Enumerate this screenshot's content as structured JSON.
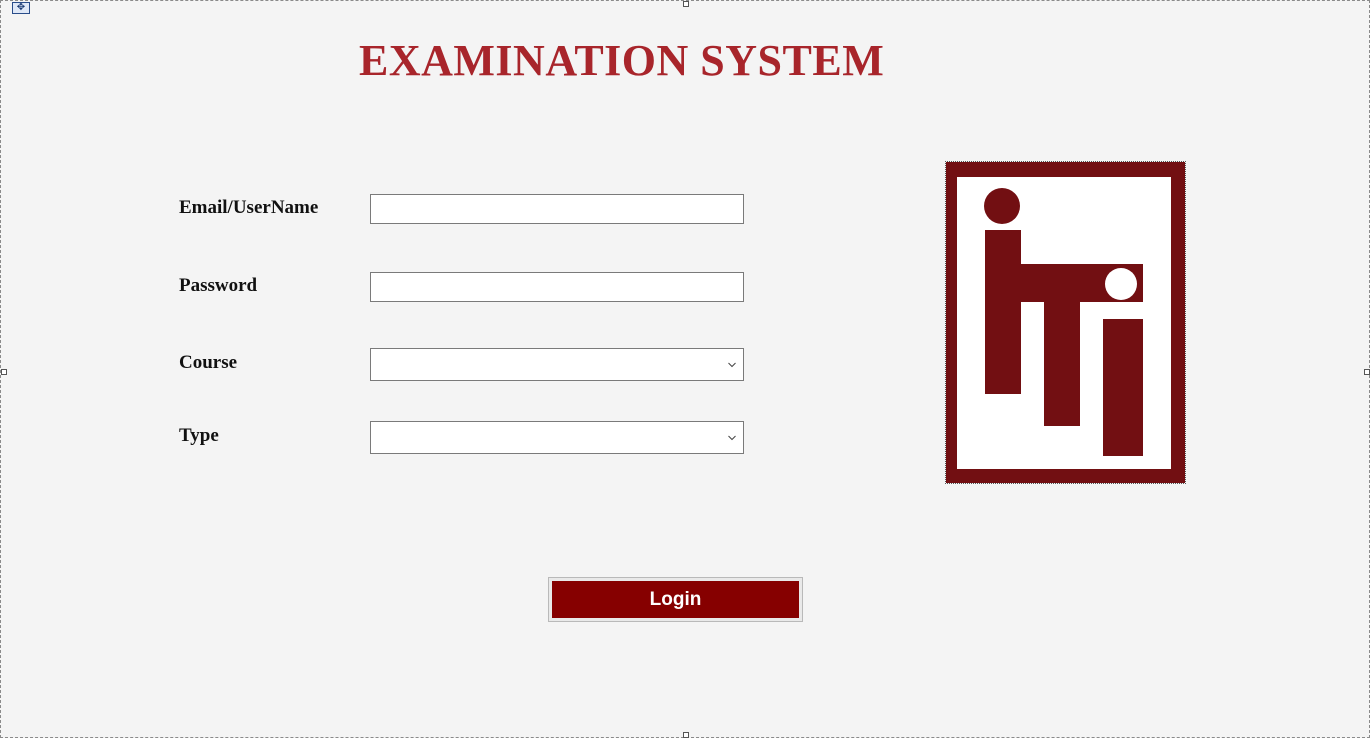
{
  "header": {
    "title": "EXAMINATION SYSTEM"
  },
  "form": {
    "email": {
      "label": "Email/UserName",
      "value": ""
    },
    "password": {
      "label": "Password",
      "value": ""
    },
    "course": {
      "label": "Course",
      "selected": ""
    },
    "type": {
      "label": "Type",
      "selected": ""
    }
  },
  "actions": {
    "login_label": "Login"
  },
  "logo": {
    "name": "iti-logo",
    "brand_color": "#720f12"
  },
  "colors": {
    "title": "#a8252b",
    "button": "#860000",
    "background": "#f4f4f4"
  }
}
